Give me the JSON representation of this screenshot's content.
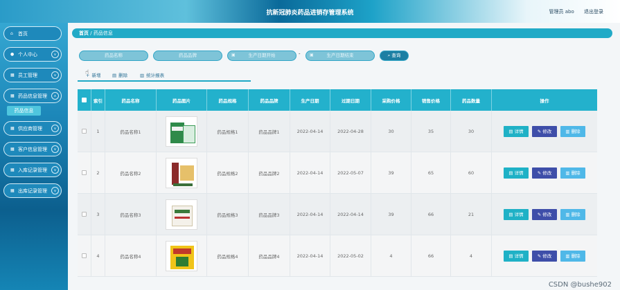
{
  "header": {
    "title": "抗新冠肺炎药品进销存管理系统",
    "user_label": "管理员 abo",
    "logout_label": "退出登录"
  },
  "sidebar": {
    "items": [
      {
        "label": "首页",
        "icon": "home-icon",
        "has_chevron": false
      },
      {
        "label": "个人中心",
        "icon": "user-icon",
        "has_chevron": true
      },
      {
        "label": "员工管理",
        "icon": "grid-icon",
        "has_chevron": true
      },
      {
        "label": "药品信息管理",
        "icon": "grid-icon",
        "has_chevron": true
      },
      {
        "label": "供应商管理",
        "icon": "grid-icon",
        "has_chevron": true
      },
      {
        "label": "客户信息管理",
        "icon": "grid-icon",
        "has_chevron": true
      },
      {
        "label": "入库记录管理",
        "icon": "grid-icon",
        "has_chevron": true
      },
      {
        "label": "出库记录管理",
        "icon": "grid-icon",
        "has_chevron": true
      }
    ],
    "active_subitem": "药品信息"
  },
  "breadcrumb": {
    "home": "首页",
    "separator": "/",
    "current": "药品信息"
  },
  "search": {
    "name_placeholder": "药品名称",
    "brand_placeholder": "药品品牌",
    "date_start_placeholder": "生产日期开始",
    "date_end_placeholder": "生产日期结束",
    "date_dash": "-",
    "query_label": "查询"
  },
  "toolbar": {
    "add_label": "新增",
    "delete_label": "删除",
    "stats_label": "统计报表"
  },
  "table": {
    "columns": [
      "索引",
      "药品名称",
      "药品图片",
      "药品规格",
      "药品品牌",
      "生产日期",
      "过期日期",
      "采购价格",
      "销售价格",
      "药品数量",
      "操作"
    ],
    "rows": [
      {
        "index": "1",
        "name": "药品名称1",
        "spec": "药品规格1",
        "brand": "药品品牌1",
        "prod_date": "2022-04-14",
        "exp_date": "2022-04-28",
        "buy_price": "30",
        "sell_price": "35",
        "qty": "30"
      },
      {
        "index": "2",
        "name": "药品名称2",
        "spec": "药品规格2",
        "brand": "药品品牌2",
        "prod_date": "2022-04-14",
        "exp_date": "2022-05-07",
        "buy_price": "39",
        "sell_price": "65",
        "qty": "60"
      },
      {
        "index": "3",
        "name": "药品名称3",
        "spec": "药品规格3",
        "brand": "药品品牌3",
        "prod_date": "2022-04-14",
        "exp_date": "2022-04-14",
        "buy_price": "39",
        "sell_price": "66",
        "qty": "21"
      },
      {
        "index": "4",
        "name": "药品名称4",
        "spec": "药品规格4",
        "brand": "药品品牌4",
        "prod_date": "2022-04-14",
        "exp_date": "2022-05-02",
        "buy_price": "4",
        "sell_price": "66",
        "qty": "4"
      }
    ],
    "ops": {
      "detail_label": "详情",
      "edit_label": "修改",
      "delete_label": "删除"
    }
  },
  "watermark": "CSDN @bushe902",
  "colors": {
    "accent": "#23b1cc",
    "sidebar": "#1e89bb",
    "edit_button": "#3e4ea9",
    "delete_button": "#4fb8e8"
  }
}
